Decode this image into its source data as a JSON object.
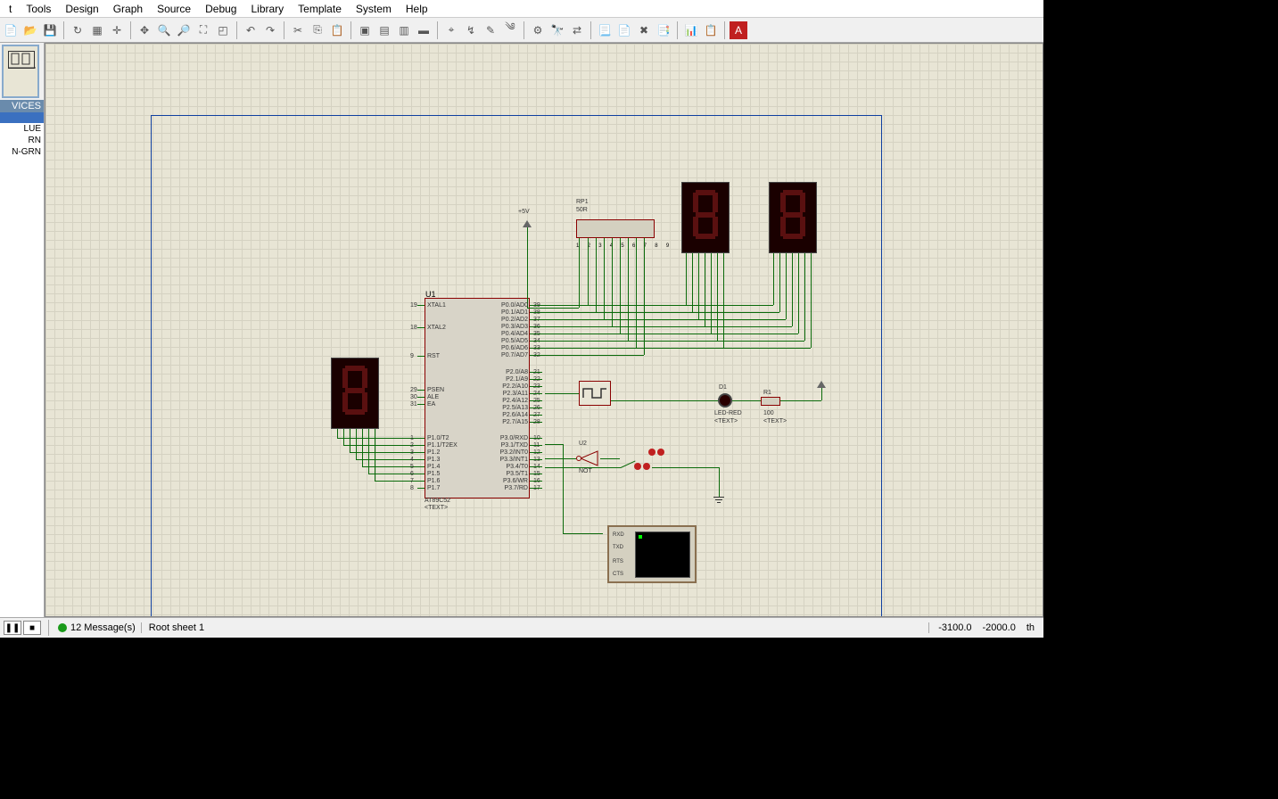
{
  "menubar": {
    "items": [
      "t",
      "Tools",
      "Design",
      "Graph",
      "Source",
      "Debug",
      "Library",
      "Template",
      "System",
      "Help"
    ]
  },
  "toolbar": {
    "groups": [
      [
        "file-new",
        "file-open",
        "file-save"
      ],
      [
        "refresh",
        "grid",
        "origin"
      ],
      [
        "pan",
        "zoom-in",
        "zoom-out",
        "zoom-fit",
        "zoom-area"
      ],
      [
        "undo",
        "redo"
      ],
      [
        "cut",
        "copy",
        "paste"
      ],
      [
        "block-copy",
        "block-move",
        "block-rotate",
        "block-delete"
      ],
      [
        "pick",
        "wire-label",
        "script",
        "text"
      ],
      [
        "compile",
        "find",
        "replace"
      ],
      [
        "report1",
        "report2",
        "report3",
        "report4"
      ],
      [
        "netlist",
        "bom"
      ],
      [
        "ares"
      ]
    ]
  },
  "sidebar": {
    "header": "VICES",
    "items": [
      "LUE",
      "RN",
      "N-GRN"
    ],
    "selected": 0,
    "preview_empty": ""
  },
  "schematic": {
    "chip": {
      "ref": "U1",
      "part": "AT89C52",
      "text_marker": "<TEXT>",
      "left_pins": [
        {
          "num": "19",
          "name": "XTAL1"
        },
        {
          "num": "18",
          "name": "XTAL2"
        },
        {
          "num": "9",
          "name": "RST"
        },
        {
          "num": "29",
          "name": "PSEN"
        },
        {
          "num": "30",
          "name": "ALE"
        },
        {
          "num": "31",
          "name": "EA"
        },
        {
          "num": "1",
          "name": "P1.0/T2"
        },
        {
          "num": "2",
          "name": "P1.1/T2EX"
        },
        {
          "num": "3",
          "name": "P1.2"
        },
        {
          "num": "4",
          "name": "P1.3"
        },
        {
          "num": "5",
          "name": "P1.4"
        },
        {
          "num": "6",
          "name": "P1.5"
        },
        {
          "num": "7",
          "name": "P1.6"
        },
        {
          "num": "8",
          "name": "P1.7"
        }
      ],
      "right_pins": [
        {
          "num": "39",
          "name": "P0.0/AD0"
        },
        {
          "num": "38",
          "name": "P0.1/AD1"
        },
        {
          "num": "37",
          "name": "P0.2/AD2"
        },
        {
          "num": "36",
          "name": "P0.3/AD3"
        },
        {
          "num": "35",
          "name": "P0.4/AD4"
        },
        {
          "num": "34",
          "name": "P0.5/AD5"
        },
        {
          "num": "33",
          "name": "P0.6/AD6"
        },
        {
          "num": "32",
          "name": "P0.7/AD7"
        },
        {
          "num": "21",
          "name": "P2.0/A8"
        },
        {
          "num": "22",
          "name": "P2.1/A9"
        },
        {
          "num": "23",
          "name": "P2.2/A10"
        },
        {
          "num": "24",
          "name": "P2.3/A11"
        },
        {
          "num": "25",
          "name": "P2.4/A12"
        },
        {
          "num": "26",
          "name": "P2.5/A13"
        },
        {
          "num": "27",
          "name": "P2.6/A14"
        },
        {
          "num": "28",
          "name": "P2.7/A15"
        },
        {
          "num": "10",
          "name": "P3.0/RXD"
        },
        {
          "num": "11",
          "name": "P3.1/TXD"
        },
        {
          "num": "12",
          "name": "P3.2/INT0"
        },
        {
          "num": "13",
          "name": "P3.3/INT1"
        },
        {
          "num": "14",
          "name": "P3.4/T0"
        },
        {
          "num": "15",
          "name": "P3.5/T1"
        },
        {
          "num": "16",
          "name": "P3.6/WR"
        },
        {
          "num": "17",
          "name": "P3.7/RD"
        }
      ]
    },
    "respack": {
      "ref": "RP1",
      "val": "50R",
      "pins": "1 2 3 4 5 6 7 8 9"
    },
    "power": {
      "label": "+5V"
    },
    "not_gate": {
      "ref": "U2",
      "name": "NOT"
    },
    "led": {
      "ref": "D1",
      "name": "LED-RED",
      "text_marker": "<TEXT>"
    },
    "resistor": {
      "ref": "R1",
      "val": "100",
      "text_marker": "<TEXT>"
    },
    "terminal": {
      "pins": [
        "RXD",
        "TXD",
        "RTS",
        "CTS"
      ]
    }
  },
  "statusbar": {
    "messages": "12 Message(s)",
    "sheet": "Root sheet 1",
    "coord_x": "-3100.0",
    "coord_y": "-2000.0",
    "units": "th"
  }
}
